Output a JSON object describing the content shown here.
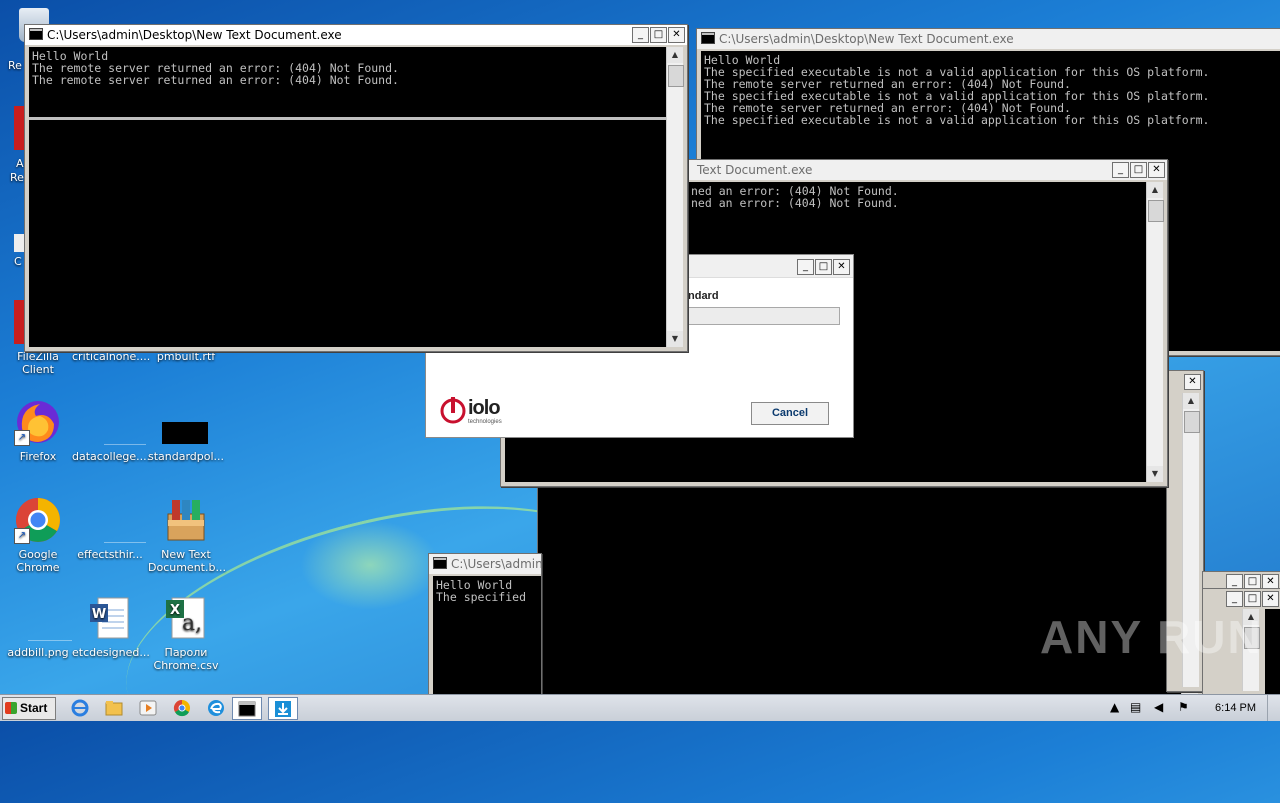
{
  "desktop": {
    "icons": [
      {
        "label": "FileZilla Client"
      },
      {
        "label": "criticalnone...."
      },
      {
        "label": "pmbuilt.rtf"
      },
      {
        "label": "Firefox"
      },
      {
        "label": "datacollege...."
      },
      {
        "label": "standardpol..."
      },
      {
        "label": "Google Chrome"
      },
      {
        "label": "effectsthir..."
      },
      {
        "label": "New Text Document.b..."
      },
      {
        "label": "addbill.png"
      },
      {
        "label": "etcdesigned..."
      },
      {
        "label": "Пароли Chrome.csv"
      }
    ],
    "partial_labels": [
      "Re",
      "A",
      "Re",
      "C"
    ]
  },
  "windows": {
    "front": {
      "title": "C:\\Users\\admin\\Desktop\\New Text Document.exe",
      "lines": "Hello World\nThe remote server returned an error: (404) Not Found.\nThe remote server returned an error: (404) Not Found."
    },
    "right": {
      "title": "C:\\Users\\admin\\Desktop\\New Text Document.exe",
      "lines": "Hello World\nThe specified executable is not a valid application for this OS platform.\nThe remote server returned an error: (404) Not Found.\nThe specified executable is not a valid application for this OS platform.\nThe remote server returned an error: (404) Not Found.\nThe specified executable is not a valid application for this OS platform."
    },
    "middle": {
      "title": "Text Document.exe",
      "lines": "ned an error: (404) Not Found.\nned an error: (404) Not Found."
    },
    "small": {
      "title": "C:\\Users\\admin",
      "lines": "Hello World\nThe specified"
    }
  },
  "dialog": {
    "text": "ndard",
    "cancel": "Cancel",
    "logo_text": "iolo",
    "logo_sub": "technologies"
  },
  "taskbar": {
    "start": "Start",
    "clock": "6:14 PM"
  },
  "watermark": "ANY RUN"
}
